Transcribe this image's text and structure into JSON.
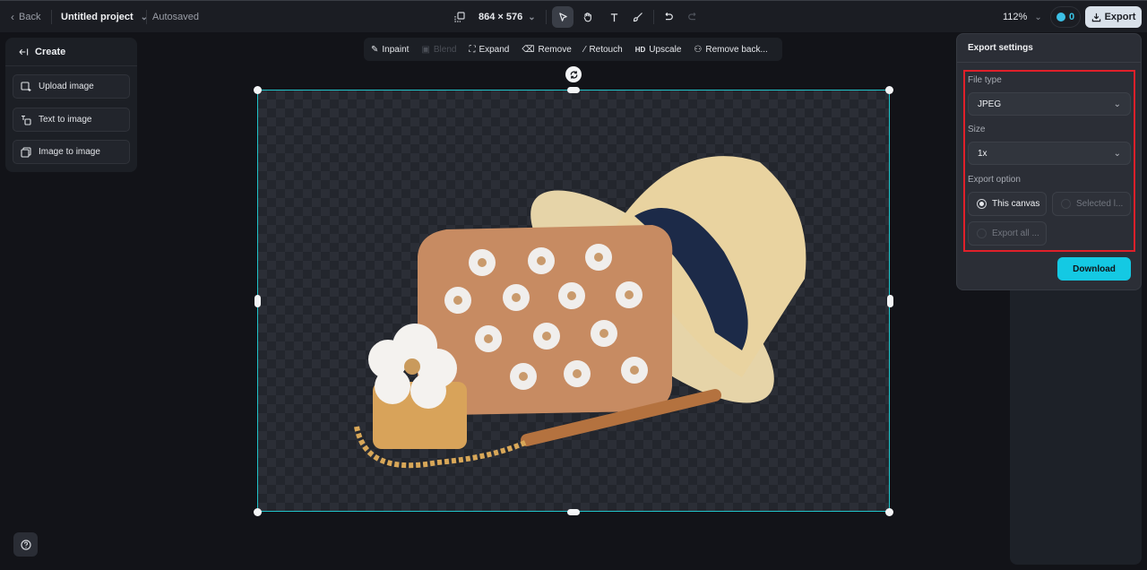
{
  "topbar": {
    "back_label": "Back",
    "project_title": "Untitled project",
    "save_status": "Autosaved",
    "canvas_size": "864 × 576",
    "zoom_level": "112%",
    "credits": "0",
    "export_label": "Export",
    "tools": [
      {
        "name": "select",
        "active": true
      },
      {
        "name": "hand"
      },
      {
        "name": "text"
      },
      {
        "name": "brush"
      },
      {
        "name": "undo"
      },
      {
        "name": "redo",
        "disabled": true
      }
    ]
  },
  "create_panel": {
    "title": "Create",
    "items": [
      {
        "label": "Upload image",
        "icon": "upload-image-icon"
      },
      {
        "label": "Text to image",
        "icon": "text-to-image-icon"
      },
      {
        "label": "Image to image",
        "icon": "image-to-image-icon"
      }
    ]
  },
  "edit_toolbar": {
    "items": [
      {
        "label": "Inpaint",
        "icon": "inpaint-icon"
      },
      {
        "label": "Blend",
        "icon": "blend-icon",
        "disabled": true
      },
      {
        "label": "Expand",
        "icon": "expand-icon"
      },
      {
        "label": "Remove",
        "icon": "eraser-icon"
      },
      {
        "label": "Retouch",
        "icon": "magic-wand-icon"
      },
      {
        "label": "Upscale",
        "icon": "hd-icon",
        "badge": "HD"
      },
      {
        "label": "Remove back...",
        "icon": "remove-background-icon"
      }
    ]
  },
  "canvas": {
    "image_description": "Straw boater hat with navy ribbon, tan flower-appliqué crossbody bag with gold chain, and Daisy perfume bottle on transparent background",
    "selection_color": "#20c3c9"
  },
  "export_settings": {
    "title": "Export settings",
    "file_type_label": "File type",
    "file_type_value": "JPEG",
    "size_label": "Size",
    "size_value": "1x",
    "export_option_label": "Export option",
    "options": [
      {
        "label": "This canvas",
        "selected": true
      },
      {
        "label": "Selected l...",
        "selected": false
      },
      {
        "label": "Export all ...",
        "selected": false
      }
    ],
    "download_label": "Download",
    "accent_color": "#14c9e3",
    "highlight_color": "#e0202a"
  }
}
